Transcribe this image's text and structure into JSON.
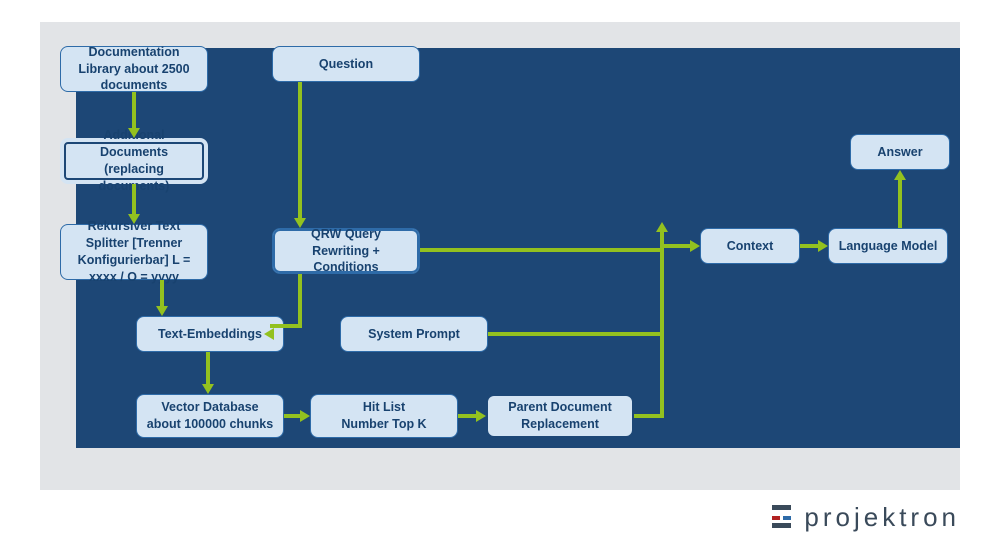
{
  "colors": {
    "bg_outer": "#e2e4e7",
    "bg_inner": "#1d4776",
    "node_fill": "#d4e4f3",
    "node_border": "#2e6ba8",
    "arrow": "#93c11f"
  },
  "brand": {
    "name": "projektron"
  },
  "nodes": {
    "docLib": "Documentation Library about 2500 documents",
    "addDocs": "Additional Documents (replacing documents)",
    "splitter": "Rekursiver Text Splitter [Trenner Konfigurierbar] L = xxxx / O = yyyy",
    "embeddings": "Text-Embeddings",
    "vectorDb": "Vector Database\nabout 100000 chunks",
    "question": "Question",
    "qrw": "QRW Query Rewriting + Conditions",
    "sysPrompt": "System Prompt",
    "hitList": "Hit List\nNumber Top K",
    "parentRepl": "Parent Document Replacement",
    "context": "Context",
    "langModel": "Language Model",
    "answer": "Answer"
  }
}
